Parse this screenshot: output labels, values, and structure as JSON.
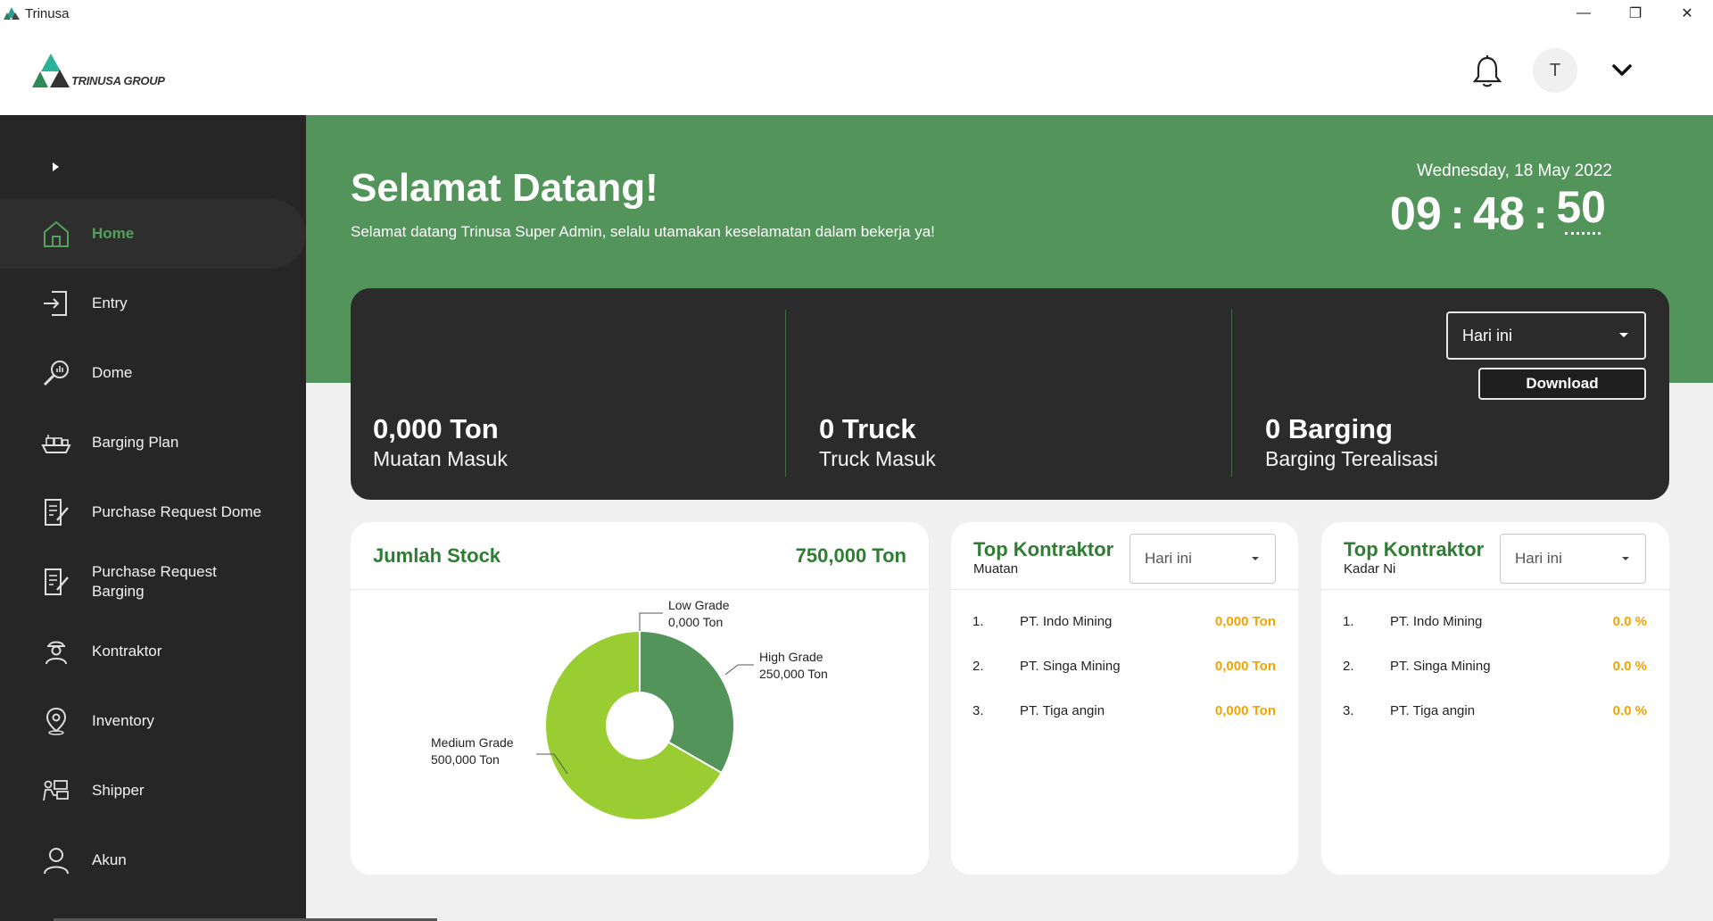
{
  "window": {
    "title": "Trinusa",
    "minimize": "—",
    "restore": "❐",
    "close": "✕"
  },
  "header": {
    "brand": "TRINUSA GROUP",
    "avatar_letter": "T"
  },
  "sidebar": {
    "items": [
      {
        "label": "Home",
        "icon": "home-icon",
        "active": true
      },
      {
        "label": "Entry",
        "icon": "entry-icon"
      },
      {
        "label": "Dome",
        "icon": "dome-icon"
      },
      {
        "label": "Barging Plan",
        "icon": "ship-icon"
      },
      {
        "label": "Purchase Request Dome",
        "icon": "document-edit-icon"
      },
      {
        "label": "Purchase Request Barging",
        "icon": "document-edit-icon"
      },
      {
        "label": "Kontraktor",
        "icon": "worker-icon"
      },
      {
        "label": "Inventory",
        "icon": "location-pin-icon"
      },
      {
        "label": "Shipper",
        "icon": "shipper-icon"
      },
      {
        "label": "Akun",
        "icon": "user-icon"
      }
    ]
  },
  "banner": {
    "title": "Selamat Datang!",
    "subtitle": "Selamat datang Trinusa Super Admin, selalu utamakan keselamatan dalam bekerja ya!",
    "date": "Wednesday, 18 May 2022",
    "clock": {
      "hours": "09",
      "minutes": "48",
      "seconds": "50",
      "sep": ":"
    }
  },
  "summary": {
    "period": "Hari ini",
    "download": "Download",
    "stats": [
      {
        "value": "0,000 Ton",
        "label": "Muatan Masuk"
      },
      {
        "value": "0 Truck",
        "label": "Truck Masuk"
      },
      {
        "value": "0 Barging",
        "label": "Barging Terealisasi"
      }
    ]
  },
  "stock": {
    "title": "Jumlah Stock",
    "total": "750,000 Ton"
  },
  "chart_data": {
    "type": "pie",
    "donut": true,
    "categories": [
      "Low Grade",
      "High Grade",
      "Medium Grade"
    ],
    "values": [
      0,
      250000,
      500000
    ],
    "value_labels": [
      "0,000 Ton",
      "250,000 Ton",
      "500,000 Ton"
    ],
    "colors": [
      "#2e7d32",
      "#53945a",
      "#9acd32"
    ]
  },
  "top_muatan": {
    "title": "Top Kontraktor",
    "subtitle": "Muatan",
    "period": "Hari ini",
    "rows": [
      {
        "num": "1.",
        "name": "PT. Indo Mining",
        "value": "0,000 Ton"
      },
      {
        "num": "2.",
        "name": "PT. Singa Mining",
        "value": "0,000 Ton"
      },
      {
        "num": "3.",
        "name": "PT. Tiga angin",
        "value": "0,000 Ton"
      }
    ]
  },
  "top_kadar": {
    "title": "Top Kontraktor",
    "subtitle": "Kadar Ni",
    "period": "Hari ini",
    "rows": [
      {
        "num": "1.",
        "name": "PT. Indo Mining",
        "value": "0.0 %"
      },
      {
        "num": "2.",
        "name": "PT. Singa Mining",
        "value": "0.0 %"
      },
      {
        "num": "3.",
        "name": "PT. Tiga angin",
        "value": "0.0 %"
      }
    ]
  }
}
